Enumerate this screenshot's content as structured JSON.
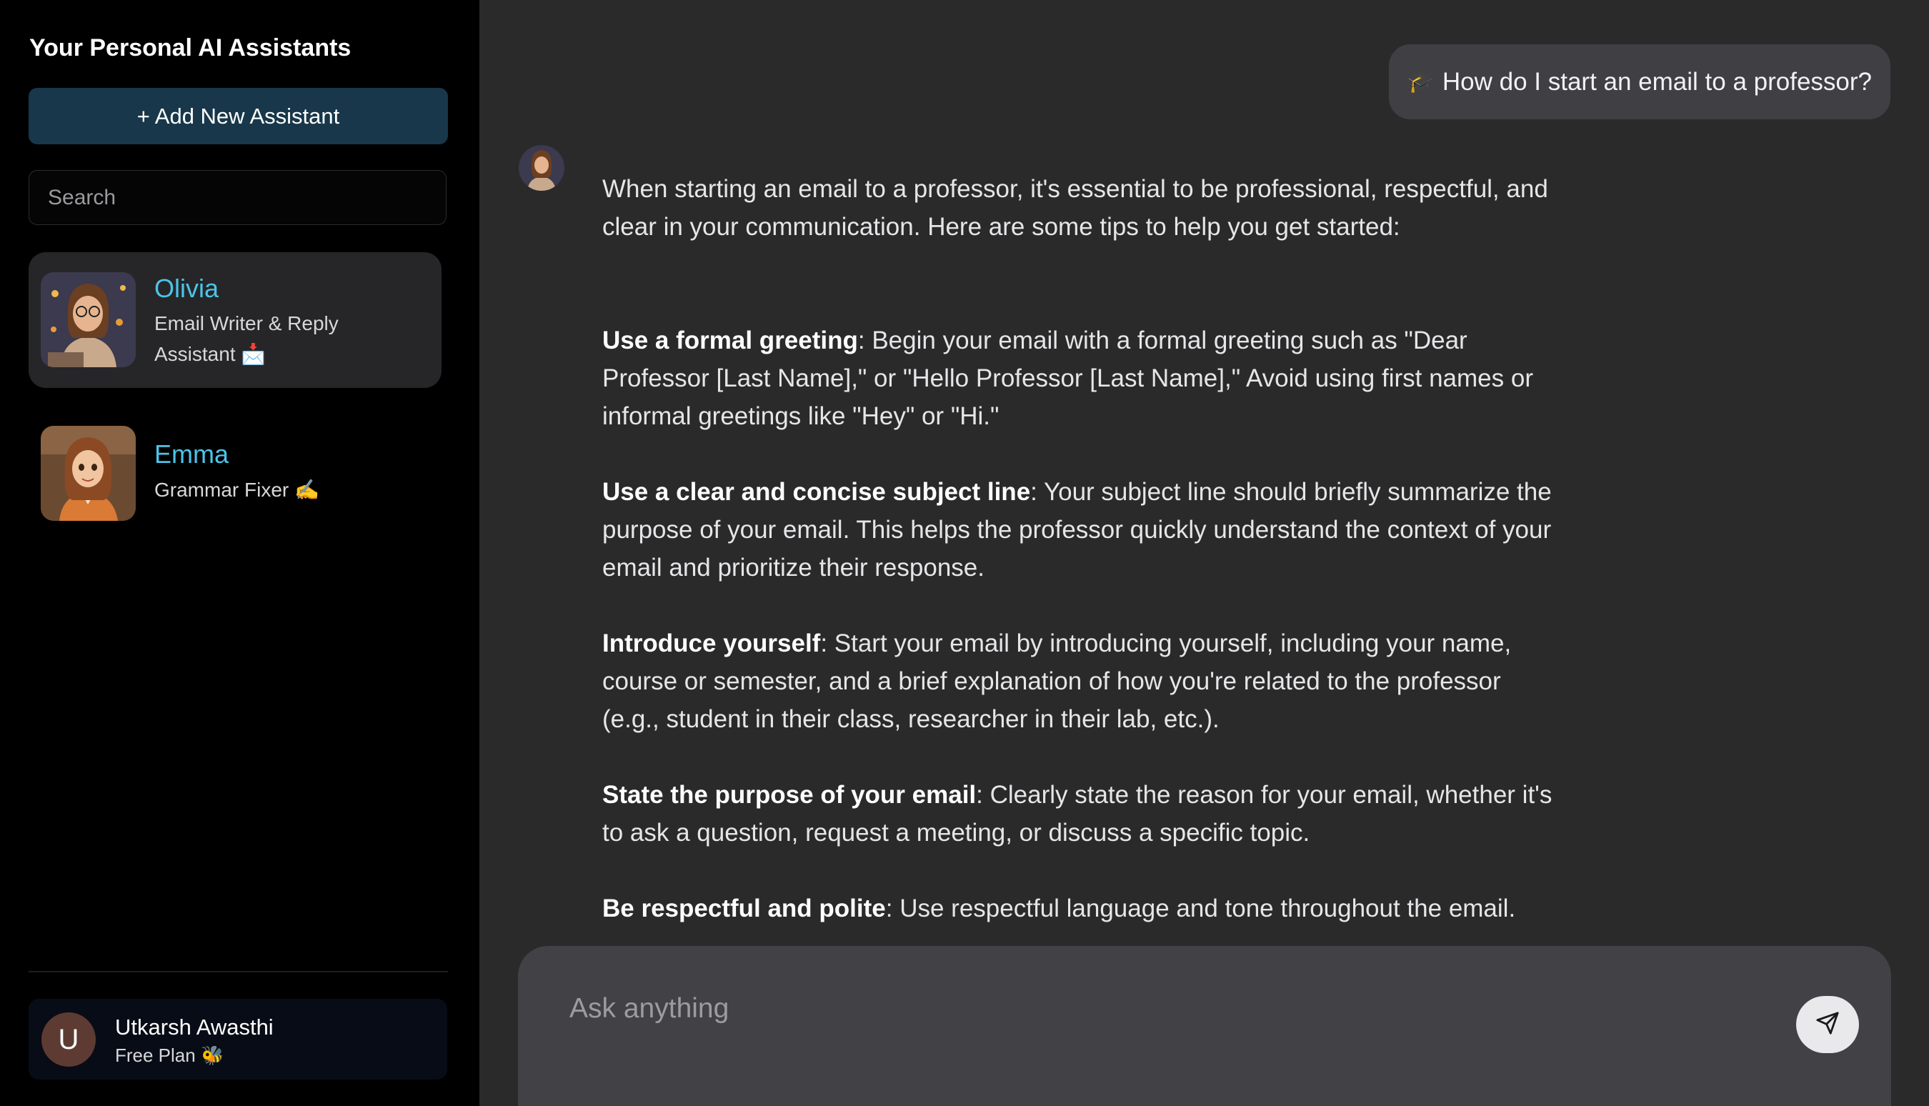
{
  "sidebar": {
    "title": "Your Personal AI Assistants",
    "add_button_label": "+ Add New Assistant",
    "search_placeholder": "Search",
    "assistants": [
      {
        "name": "Olivia",
        "description": "Email Writer & Reply Assistant 📩",
        "avatar": "olivia-portrait",
        "active": true
      },
      {
        "name": "Emma",
        "description": "Grammar Fixer ✍️",
        "avatar": "emma-portrait",
        "active": false
      }
    ],
    "user": {
      "initial": "U",
      "name": "Utkarsh Awasthi",
      "plan": "Free Plan 🐝"
    }
  },
  "chat": {
    "user_message_icon": "🎓",
    "user_message": "How do I start an email to a professor?",
    "response": {
      "intro": "When starting an email to a professor, it's essential to be professional, respectful, and clear in your communication. Here are some tips to help you get started:",
      "tips": [
        {
          "title": "Use a formal greeting",
          "text": ": Begin your email with a formal greeting such as \"Dear Professor [Last Name],\" or \"Hello Professor [Last Name],\" Avoid using first names or informal greetings like \"Hey\" or \"Hi.\""
        },
        {
          "title": "Use a clear and concise subject line",
          "text": ": Your subject line should briefly summarize the purpose of your email. This helps the professor quickly understand the context of your email and prioritize their response."
        },
        {
          "title": "Introduce yourself",
          "text": ": Start your email by introducing yourself, including your name, course or semester, and a brief explanation of how you're related to the professor (e.g., student in their class, researcher in their lab, etc.)."
        },
        {
          "title": "State the purpose of your email",
          "text": ": Clearly state the reason for your email, whether it's to ask a question, request a meeting, or discuss a specific topic."
        },
        {
          "title": "Be respectful and polite",
          "text": ": Use respectful language and tone throughout the email."
        }
      ]
    }
  },
  "composer": {
    "placeholder": "Ask anything",
    "send_icon": "send-icon"
  },
  "colors": {
    "accent": "#4cc4e8",
    "sidebar_bg": "#000000",
    "main_bg": "#2a2a2b",
    "add_button_bg": "#18374a"
  }
}
